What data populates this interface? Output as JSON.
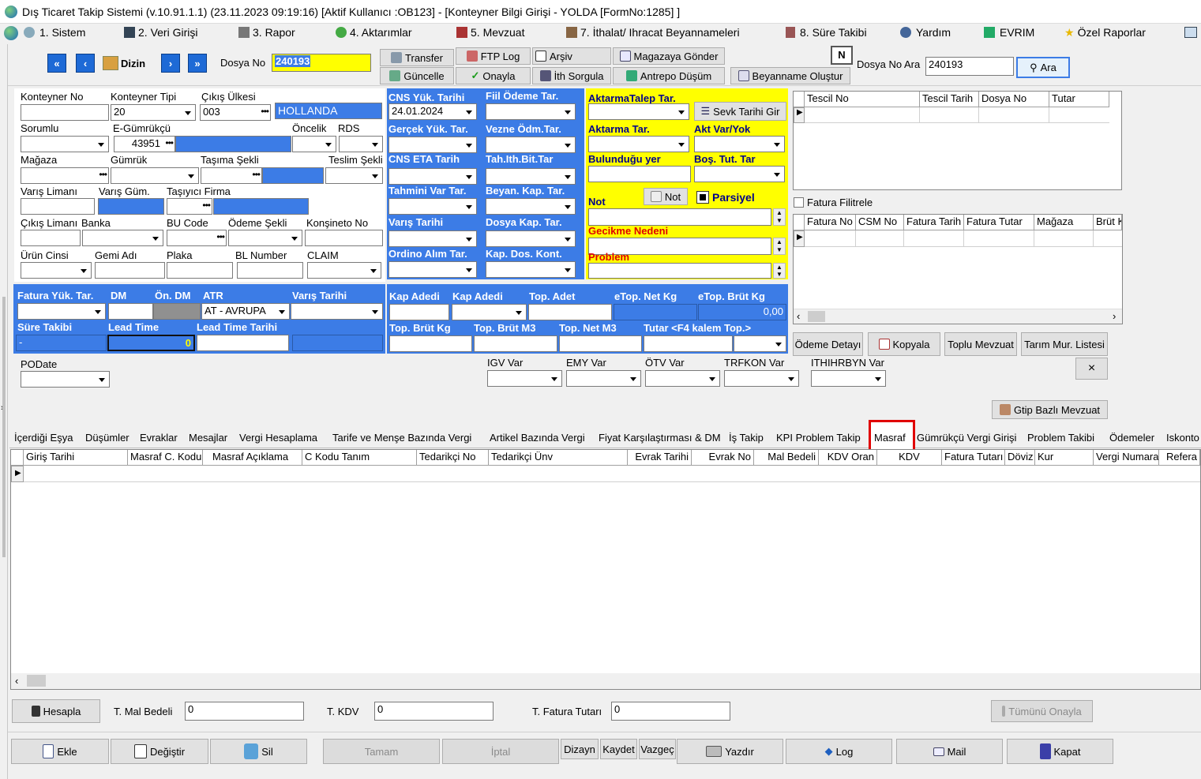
{
  "title": "Dış Ticaret Takip Sistemi (v.10.91.1.1) (23.11.2023 09:19:16) [Aktif Kullanıcı :OB123] - [Konteyner Bilgi Girişi - YOLDA [FormNo:1285] ]",
  "menu": [
    "1.  Sistem",
    "2.  Veri Girişi",
    "3.  Rapor",
    "4.  Aktarımlar",
    "5.  Mevzuat",
    "7.  İthalat/ Ihracat Beyannameleri",
    "8. Süre Takibi",
    "Yardım",
    "EVRIM",
    "Özel Raporlar"
  ],
  "toolbar": {
    "dizin": "Dizin",
    "dosya_no_label": "Dosya No",
    "dosya_no": "240193",
    "transfer": "Transfer",
    "ftp_log": "FTP Log",
    "arsiv": "Arşiv",
    "magazaya_gonder": "Magazaya Gönder",
    "guncelle": "Güncelle",
    "onayla": "Onayla",
    "ith_sorgula": "İth Sorgula",
    "antrepo_dusum": "Antrepo Düşüm",
    "beyanname_olustur": "Beyanname Oluştur",
    "n_flag": "N",
    "dosya_no_ara_label": "Dosya No Ara",
    "dosya_no_ara": "240193",
    "ara": "Ara"
  },
  "form": {
    "konteyner_no": "Konteyner No",
    "konteyner_tipi": "Konteyner Tipi",
    "konteyner_tipi_val": "20",
    "cikis_ulkesi": "Çıkış Ülkesi",
    "cikis_ulkesi_code": "003",
    "cikis_ulkesi_name": "HOLLANDA",
    "sorumlu": "Sorumlu",
    "e_gumrukcu": "E-Gümrükçü",
    "e_gumrukcu_val": "43951",
    "oncelik": "Öncelik",
    "rds": "RDS",
    "magaza": "Mağaza",
    "gumruk": "Gümrük",
    "tasima_sekli": "Taşıma Şekli",
    "teslim_sekli": "Teslim Şekli",
    "varis_limani": "Varış Limanı",
    "varis_gum": "Varış Güm.",
    "tasiyici_firma": "Taşıyıcı Firma",
    "cikis_limani": "Çıkış Limanı",
    "banka": "Banka",
    "bu_code": "BU Code",
    "odeme_sekli": "Ödeme Şekli",
    "konsineto_no": "Konşineto No",
    "urun_cinsi": "Ürün Cinsi",
    "gemi_adi": "Gemi Adı",
    "plaka": "Plaka",
    "bl_number": "BL Number",
    "claim": "CLAIM"
  },
  "dates": {
    "cns_yuk": "CNS Yük. Tarihi",
    "cns_yuk_val": "24.01.2024",
    "fiil_odeme": "Fiil Ödeme Tar.",
    "gercek_yuk": "Gerçek Yük. Tar.",
    "vezne_odm": "Vezne Ödm.Tar.",
    "cns_eta": "CNS ETA Tarih",
    "tah_ith": "Tah.Ith.Bit.Tar",
    "tahmini_var": "Tahmini Var Tar.",
    "beyan_kap": "Beyan. Kap. Tar.",
    "varis_tarihi": "Varış Tarihi",
    "dosya_kap": "Dosya Kap. Tar.",
    "ordino": "Ordino Alım Tar.",
    "kap_dos": "Kap. Dos. Kont."
  },
  "yellow": {
    "aktarma_talep": "AktarmaTalep Tar.",
    "sevk_tarihi_gir": "Sevk Tarihi Gir",
    "aktarma_tar": "Aktarma Tar.",
    "akt_var_yok": "Akt Var/Yok",
    "bulundugu_yer": "Bulunduğu yer",
    "bos_tut": "Boş. Tut. Tar",
    "not": "Not",
    "not_btn": "Not",
    "parsiyel": "Parsiyel",
    "gecikme": "Gecikme Nedeni",
    "problem": "Problem"
  },
  "tescil_headers": [
    "Tescil No",
    "Tescil Tarih",
    "Dosya No",
    "Tutar"
  ],
  "fatura_filtrele": "Fatura Filitrele",
  "fatura_headers": [
    "Fatura No",
    "CSM No",
    "Fatura Tarih",
    "Fatura Tutar",
    "Mağaza",
    "Brüt K"
  ],
  "lower_blue": {
    "fatura_yuk": "Fatura Yük. Tar.",
    "dm": "DM",
    "on_dm": "Ön. DM",
    "atr": "ATR",
    "atr_val": "AT    - AVRUPA",
    "varis_tarihi": "Varış Tarihi",
    "sure_takibi": "Süre Takibi",
    "sure_val": "-",
    "lead_time": "Lead Time",
    "lead_time_val": "0",
    "lead_time_tarihi": "Lead Time Tarihi"
  },
  "kap": {
    "kap_adedi1": "Kap Adedi",
    "kap_adedi2": "Kap Adedi",
    "top_adet": "Top. Adet",
    "etop_net": "eTop. Net Kg",
    "etop_brut": "eTop. Brüt Kg",
    "etop_brut_val": "0,00",
    "top_brut": "Top. Brüt Kg",
    "top_brut_m3": "Top. Brüt M3",
    "top_net_m3": "Top. Net M3",
    "tutar_f4": "Tutar <F4 kalem Top.>"
  },
  "right_buttons": [
    "Ödeme Detayı",
    "Kopyala",
    "Toplu Mevzuat",
    "Tarım Mur. Listesi"
  ],
  "close_x": "×",
  "podate": "PODate",
  "flags": [
    "IGV Var",
    "EMY Var",
    "ÖTV Var",
    "TRFKON Var",
    "ITHIHRBYN Var"
  ],
  "gtip": "Gtip Bazlı Mevzuat",
  "tabs": [
    "İçerdiği Eşya",
    "Düşümler",
    "Evraklar",
    "Mesajlar",
    "Vergi Hesaplama",
    "Tarife ve Menşe Bazında  Vergi",
    "Artikel Bazında Vergi",
    "Fiyat Karşılaştırması & DM",
    "İş Takip",
    "KPI Problem Takip",
    "Masraf",
    "Gümrükçü Vergi Girişi",
    "Problem Takibi",
    "Ödemeler",
    "Iskonto"
  ],
  "grid_headers": [
    "Giriş Tarihi",
    "Masraf C. Kodu",
    "Masraf Açıklama",
    "C Kodu Tanım",
    "Tedarikçi No",
    "Tedarikçi Ünv",
    "Evrak Tarihi",
    "Evrak No",
    "Mal Bedeli",
    "KDV Oran",
    "KDV",
    "Fatura Tutarı",
    "Döviz",
    "Kur",
    "Vergi Numarası",
    "Refera"
  ],
  "totals": {
    "hesapla": "Hesapla",
    "t_mal": "T. Mal Bedeli",
    "t_mal_val": "0",
    "t_kdv": "T. KDV",
    "t_kdv_val": "0",
    "t_fatura": "T. Fatura Tutarı",
    "t_fatura_val": "0",
    "tumunu": "Tümünü Onayla"
  },
  "bottom": {
    "ekle": "Ekle",
    "degistir": "Değiştir",
    "sil": "Sil",
    "tamam": "Tamam",
    "iptal": "İptal",
    "dizayn": "Dizayn",
    "kaydet": "Kaydet",
    "vazgec": "Vazgeç",
    "yazdir": "Yazdır",
    "log": "Log",
    "mail": "Mail",
    "kapat": "Kapat"
  },
  "colors": {
    "accent_blue": "#3c7ce6",
    "yellow": "#ffff00",
    "highlight_red": "#e00000"
  }
}
